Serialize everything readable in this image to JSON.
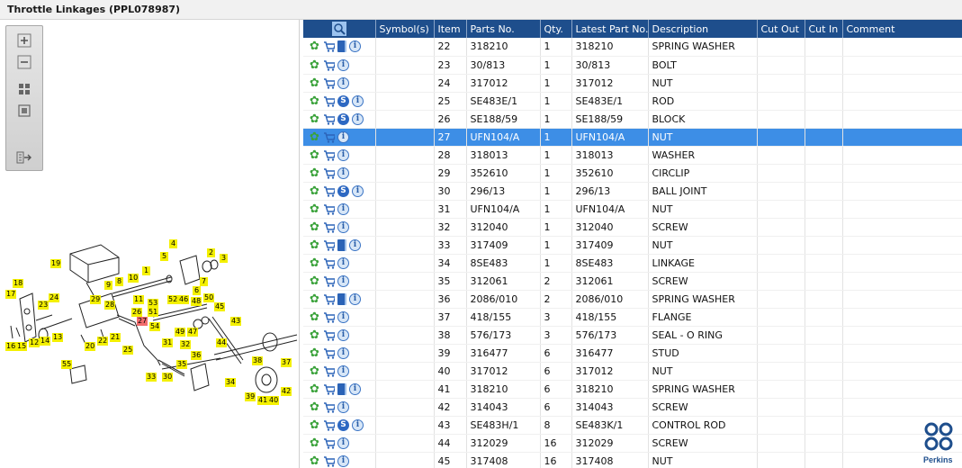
{
  "window": {
    "title": "Throttle Linkages (PPL078987)"
  },
  "toolbar": {
    "buttons": [
      {
        "name": "zoom-in",
        "icon": "plus-icon"
      },
      {
        "name": "zoom-out",
        "icon": "minus-icon"
      },
      {
        "name": "fit-all",
        "icon": "grid-icon"
      },
      {
        "name": "fit-window",
        "icon": "square-icon"
      },
      {
        "name": "export",
        "icon": "export-icon"
      }
    ]
  },
  "diagram": {
    "callouts": [
      "1",
      "2",
      "3",
      "4",
      "5",
      "6",
      "7",
      "8",
      "9",
      "10",
      "11",
      "12",
      "13",
      "14",
      "15",
      "16",
      "17",
      "18",
      "19",
      "20",
      "21",
      "22",
      "23",
      "24",
      "25",
      "26",
      "27",
      "28",
      "29",
      "30",
      "31",
      "32",
      "33",
      "34",
      "35",
      "36",
      "37",
      "38",
      "39",
      "40",
      "41",
      "42",
      "43",
      "44",
      "45",
      "46",
      "47",
      "48",
      "49",
      "50",
      "51",
      "52",
      "53",
      "54",
      "55"
    ],
    "selected_callout": "27"
  },
  "grid": {
    "columns": [
      "",
      "Symbol(s)",
      "Item",
      "Parts No.",
      "Qty.",
      "Latest Part No.",
      "Description",
      "Cut Out",
      "Cut In",
      "Comment"
    ],
    "selected_item": "27",
    "rows": [
      {
        "icons": [
          "gear",
          "cart",
          "book",
          "info"
        ],
        "symbols": "",
        "item": "22",
        "part": "318210",
        "qty": "1",
        "latest": "318210",
        "desc": "SPRING WASHER",
        "cut_out": "",
        "cut_in": "",
        "comment": ""
      },
      {
        "icons": [
          "gear",
          "cart",
          "info"
        ],
        "symbols": "",
        "item": "23",
        "part": "30/813",
        "qty": "1",
        "latest": "30/813",
        "desc": "BOLT",
        "cut_out": "",
        "cut_in": "",
        "comment": ""
      },
      {
        "icons": [
          "gear",
          "cart",
          "info"
        ],
        "symbols": "",
        "item": "24",
        "part": "317012",
        "qty": "1",
        "latest": "317012",
        "desc": "NUT",
        "cut_out": "",
        "cut_in": "",
        "comment": ""
      },
      {
        "icons": [
          "gear",
          "cart",
          "s",
          "info"
        ],
        "symbols": "",
        "item": "25",
        "part": "SE483E/1",
        "qty": "1",
        "latest": "SE483E/1",
        "desc": "ROD",
        "cut_out": "",
        "cut_in": "",
        "comment": ""
      },
      {
        "icons": [
          "gear",
          "cart",
          "s",
          "info"
        ],
        "symbols": "",
        "item": "26",
        "part": "SE188/59",
        "qty": "1",
        "latest": "SE188/59",
        "desc": "BLOCK",
        "cut_out": "",
        "cut_in": "",
        "comment": ""
      },
      {
        "icons": [
          "gear",
          "cart",
          "info"
        ],
        "symbols": "",
        "item": "27",
        "part": "UFN104/A",
        "qty": "1",
        "latest": "UFN104/A",
        "desc": "NUT",
        "cut_out": "",
        "cut_in": "",
        "comment": ""
      },
      {
        "icons": [
          "gear",
          "cart",
          "info"
        ],
        "symbols": "",
        "item": "28",
        "part": "318013",
        "qty": "1",
        "latest": "318013",
        "desc": "WASHER",
        "cut_out": "",
        "cut_in": "",
        "comment": ""
      },
      {
        "icons": [
          "gear",
          "cart",
          "info"
        ],
        "symbols": "",
        "item": "29",
        "part": "352610",
        "qty": "1",
        "latest": "352610",
        "desc": "CIRCLIP",
        "cut_out": "",
        "cut_in": "",
        "comment": ""
      },
      {
        "icons": [
          "gear",
          "cart",
          "s",
          "info"
        ],
        "symbols": "",
        "item": "30",
        "part": "296/13",
        "qty": "1",
        "latest": "296/13",
        "desc": "BALL JOINT",
        "cut_out": "",
        "cut_in": "",
        "comment": ""
      },
      {
        "icons": [
          "gear",
          "cart",
          "info"
        ],
        "symbols": "",
        "item": "31",
        "part": "UFN104/A",
        "qty": "1",
        "latest": "UFN104/A",
        "desc": "NUT",
        "cut_out": "",
        "cut_in": "",
        "comment": ""
      },
      {
        "icons": [
          "gear",
          "cart",
          "info"
        ],
        "symbols": "",
        "item": "32",
        "part": "312040",
        "qty": "1",
        "latest": "312040",
        "desc": "SCREW",
        "cut_out": "",
        "cut_in": "",
        "comment": ""
      },
      {
        "icons": [
          "gear",
          "cart",
          "book",
          "info"
        ],
        "symbols": "",
        "item": "33",
        "part": "317409",
        "qty": "1",
        "latest": "317409",
        "desc": "NUT",
        "cut_out": "",
        "cut_in": "",
        "comment": ""
      },
      {
        "icons": [
          "gear",
          "cart",
          "info"
        ],
        "symbols": "",
        "item": "34",
        "part": "8SE483",
        "qty": "1",
        "latest": "8SE483",
        "desc": "LINKAGE",
        "cut_out": "",
        "cut_in": "",
        "comment": ""
      },
      {
        "icons": [
          "gear",
          "cart",
          "info"
        ],
        "symbols": "",
        "item": "35",
        "part": "312061",
        "qty": "2",
        "latest": "312061",
        "desc": "SCREW",
        "cut_out": "",
        "cut_in": "",
        "comment": ""
      },
      {
        "icons": [
          "gear",
          "cart",
          "book",
          "info"
        ],
        "symbols": "",
        "item": "36",
        "part": "2086/010",
        "qty": "2",
        "latest": "2086/010",
        "desc": "SPRING WASHER",
        "cut_out": "",
        "cut_in": "",
        "comment": ""
      },
      {
        "icons": [
          "gear",
          "cart",
          "info"
        ],
        "symbols": "",
        "item": "37",
        "part": "418/155",
        "qty": "3",
        "latest": "418/155",
        "desc": "FLANGE",
        "cut_out": "",
        "cut_in": "",
        "comment": ""
      },
      {
        "icons": [
          "gear",
          "cart",
          "info"
        ],
        "symbols": "",
        "item": "38",
        "part": "576/173",
        "qty": "3",
        "latest": "576/173",
        "desc": "SEAL - O RING",
        "cut_out": "",
        "cut_in": "",
        "comment": ""
      },
      {
        "icons": [
          "gear",
          "cart",
          "info"
        ],
        "symbols": "",
        "item": "39",
        "part": "316477",
        "qty": "6",
        "latest": "316477",
        "desc": "STUD",
        "cut_out": "",
        "cut_in": "",
        "comment": ""
      },
      {
        "icons": [
          "gear",
          "cart",
          "info"
        ],
        "symbols": "",
        "item": "40",
        "part": "317012",
        "qty": "6",
        "latest": "317012",
        "desc": "NUT",
        "cut_out": "",
        "cut_in": "",
        "comment": ""
      },
      {
        "icons": [
          "gear",
          "cart",
          "book",
          "info"
        ],
        "symbols": "",
        "item": "41",
        "part": "318210",
        "qty": "6",
        "latest": "318210",
        "desc": "SPRING WASHER",
        "cut_out": "",
        "cut_in": "",
        "comment": ""
      },
      {
        "icons": [
          "gear",
          "cart",
          "info"
        ],
        "symbols": "",
        "item": "42",
        "part": "314043",
        "qty": "6",
        "latest": "314043",
        "desc": "SCREW",
        "cut_out": "",
        "cut_in": "",
        "comment": ""
      },
      {
        "icons": [
          "gear",
          "cart",
          "s",
          "info"
        ],
        "symbols": "",
        "item": "43",
        "part": "SE483H/1",
        "qty": "8",
        "latest": "SE483K/1",
        "desc": "CONTROL ROD",
        "cut_out": "",
        "cut_in": "",
        "comment": ""
      },
      {
        "icons": [
          "gear",
          "cart",
          "info"
        ],
        "symbols": "",
        "item": "44",
        "part": "312029",
        "qty": "16",
        "latest": "312029",
        "desc": "SCREW",
        "cut_out": "",
        "cut_in": "",
        "comment": ""
      },
      {
        "icons": [
          "gear",
          "cart",
          "info"
        ],
        "symbols": "",
        "item": "45",
        "part": "317408",
        "qty": "16",
        "latest": "317408",
        "desc": "NUT",
        "cut_out": "",
        "cut_in": "",
        "comment": ""
      }
    ]
  },
  "logo": {
    "text": "Perkins",
    "color": "#1e4e8c"
  },
  "colors": {
    "header": "#1e4e8c",
    "selected_row": "#3d8ee6",
    "callout": "#f4f000",
    "callout_selected": "#f26d6d"
  }
}
